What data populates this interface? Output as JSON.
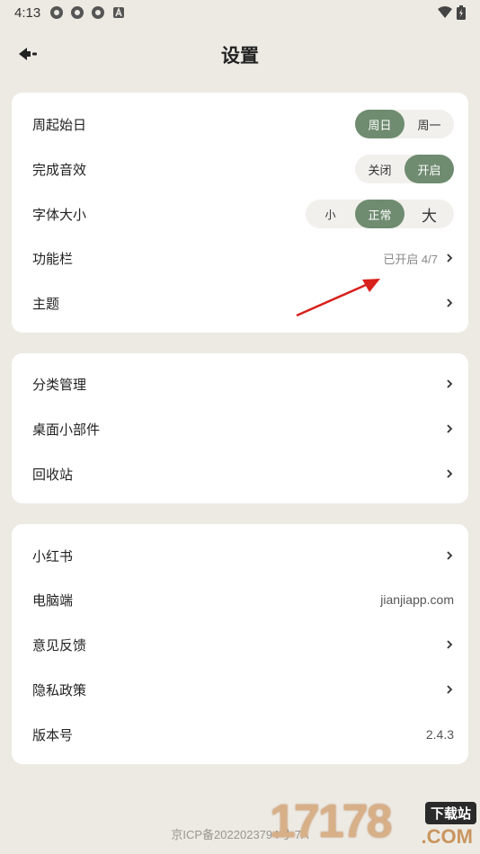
{
  "status_bar": {
    "time": "4:13"
  },
  "header": {
    "title": "设置"
  },
  "group1": {
    "week_start": {
      "label": "周起始日",
      "options": [
        "周日",
        "周一"
      ],
      "selected": "周日"
    },
    "sound": {
      "label": "完成音效",
      "options": [
        "关闭",
        "开启"
      ],
      "selected": "开启"
    },
    "font_size": {
      "label": "字体大小",
      "options": [
        "小",
        "正常",
        "大"
      ],
      "selected": "正常"
    },
    "toolbar": {
      "label": "功能栏",
      "value": "已开启 4/7"
    },
    "theme": {
      "label": "主题"
    }
  },
  "group2": {
    "category": {
      "label": "分类管理"
    },
    "widget": {
      "label": "桌面小部件"
    },
    "trash": {
      "label": "回收站"
    }
  },
  "group3": {
    "xiaohongshu": {
      "label": "小红书"
    },
    "desktop": {
      "label": "电脑端",
      "value": "jianjiapp.com"
    },
    "feedback": {
      "label": "意见反馈"
    },
    "privacy": {
      "label": "隐私政策"
    },
    "version": {
      "label": "版本号",
      "value": "2.4.3"
    }
  },
  "footer": {
    "icp": "京ICP备2022023794号-7A"
  },
  "watermark": {
    "digits": "17178",
    "tag": "下载站",
    "domain": ".COM"
  },
  "colors": {
    "accent": "#6F8B70",
    "background": "#EDEAE3",
    "annotation_arrow": "#D8201C"
  }
}
